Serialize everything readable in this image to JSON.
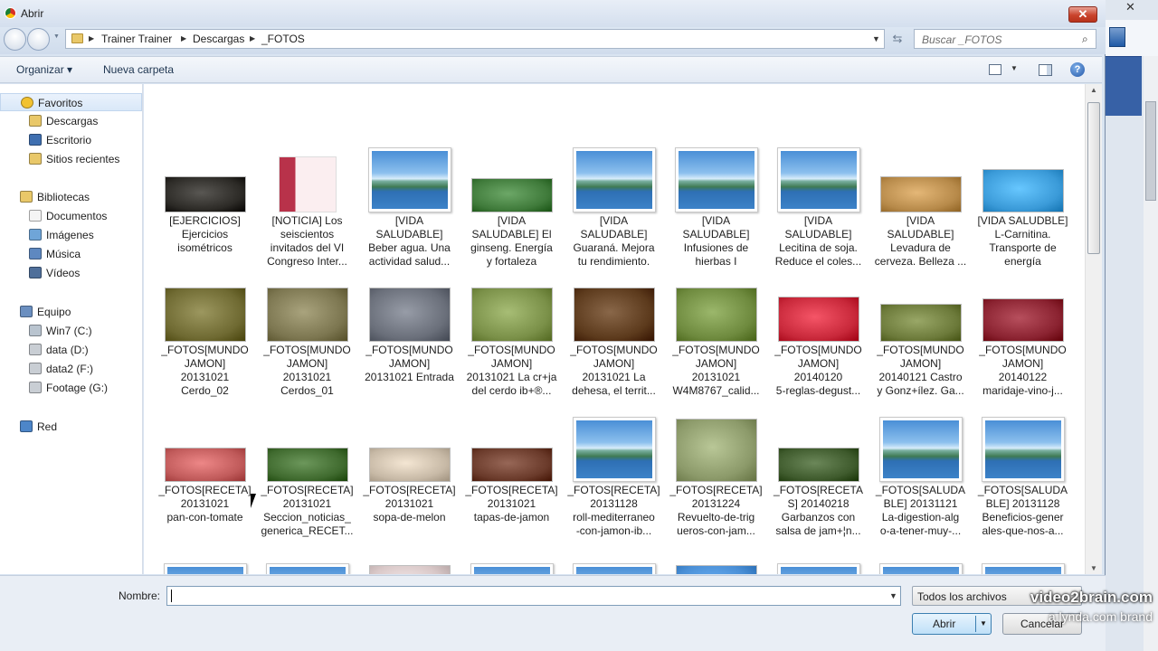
{
  "window": {
    "title": "Abrir",
    "close_glyph": "✕"
  },
  "address": {
    "crumbs": [
      "Trainer Trainer",
      "Descargas",
      "_FOTOS"
    ],
    "search_placeholder": "Buscar _FOTOS"
  },
  "toolbar": {
    "organize_label": "Organizar ▾",
    "new_folder_label": "Nueva carpeta",
    "help_glyph": "?"
  },
  "nav": {
    "items": [
      {
        "label": "Favoritos",
        "icon": "star-icon",
        "level": 0,
        "selected": true
      },
      {
        "label": "Descargas",
        "icon": "downloads-folder-icon",
        "level": 1
      },
      {
        "label": "Escritorio",
        "icon": "desktop-icon",
        "level": 1
      },
      {
        "label": "Sitios recientes",
        "icon": "recent-places-icon",
        "level": 1
      },
      {
        "label": "Bibliotecas",
        "icon": "libraries-icon",
        "level": 0
      },
      {
        "label": "Documentos",
        "icon": "documents-icon",
        "level": 1
      },
      {
        "label": "Imágenes",
        "icon": "pictures-icon",
        "level": 1
      },
      {
        "label": "Música",
        "icon": "music-icon",
        "level": 1
      },
      {
        "label": "Vídeos",
        "icon": "videos-icon",
        "level": 1
      },
      {
        "label": "Equipo",
        "icon": "computer-icon",
        "level": 0
      },
      {
        "label": "Win7 (C:)",
        "icon": "system-drive-icon",
        "level": 1
      },
      {
        "label": "data (D:)",
        "icon": "drive-icon",
        "level": 1
      },
      {
        "label": "data2 (F:)",
        "icon": "drive-icon",
        "level": 1
      },
      {
        "label": "Footage (G:)",
        "icon": "drive-icon",
        "level": 1
      },
      {
        "label": "Red",
        "icon": "network-icon",
        "level": 0
      }
    ]
  },
  "files": [
    {
      "caption": "[EJERCICIOS] Ejercicios isométricos",
      "lines": [
        "[EJERCICIOS]",
        "Ejercicios",
        "isométricos"
      ],
      "thumb": "photo-dark",
      "color": "#2c2a26"
    },
    {
      "caption": "[NOTICIA] Los seiscientos invitados del VI Congreso Inter...",
      "lines": [
        "[NOTICIA] Los",
        "seiscientos",
        "invitados del VI",
        "Congreso Inter..."
      ],
      "thumb": "document",
      "color": "#b8324a"
    },
    {
      "caption": "[VIDA SALUDABLE] Beber agua. Una actividad salud...",
      "lines": [
        "[VIDA",
        "SALUDABLE]",
        "Beber agua. Una",
        "actividad salud..."
      ],
      "thumb": "landscape"
    },
    {
      "caption": "[VIDA SALUDABLE] El ginseng. Energía y fortaleza",
      "lines": [
        "[VIDA",
        "SALUDABLE] El",
        "ginseng. Energía",
        "y fortaleza"
      ],
      "thumb": "photo",
      "color": "#3f7a3a"
    },
    {
      "caption": "[VIDA SALUDABLE] Guaraná. Mejora tu rendimiento.",
      "lines": [
        "[VIDA",
        "SALUDABLE]",
        "Guaraná. Mejora",
        "tu rendimiento."
      ],
      "thumb": "landscape"
    },
    {
      "caption": "[VIDA SALUDABLE] Infusiones de hierbas I",
      "lines": [
        "[VIDA",
        "SALUDABLE]",
        "Infusiones de",
        "hierbas I"
      ],
      "thumb": "landscape"
    },
    {
      "caption": "[VIDA SALUDABLE] Lecitina de soja. Reduce el coles...",
      "lines": [
        "[VIDA",
        "SALUDABLE]",
        "Lecitina de soja.",
        "Reduce el coles..."
      ],
      "thumb": "landscape"
    },
    {
      "caption": "[VIDA SALUDABLE] Levadura de cerveza. Belleza ...",
      "lines": [
        "[VIDA",
        "SALUDABLE]",
        "Levadura de",
        "cerveza. Belleza ..."
      ],
      "thumb": "photo",
      "color": "#b78a4a"
    },
    {
      "caption": "[VIDA SALUDBLE] L-Carnitina. Transporte de energía",
      "lines": [
        "[VIDA SALUDBLE]",
        "L-Carnitina.",
        "Transporte de",
        "energía"
      ],
      "thumb": "photo",
      "color": "#3a9ad8"
    },
    {
      "caption": "_FOTOS[MUNDO JAMON] 20131021 Cerdo_02",
      "lines": [
        "_FOTOS[MUNDO",
        "JAMON]",
        "20131021",
        "Cerdo_02"
      ],
      "thumb": "photo",
      "color": "#6f6a32"
    },
    {
      "caption": "_FOTOS[MUNDO JAMON] 20131021 Cerdos_01",
      "lines": [
        "_FOTOS[MUNDO",
        "JAMON]",
        "20131021",
        "Cerdos_01"
      ],
      "thumb": "photo",
      "color": "#7c7650"
    },
    {
      "caption": "_FOTOS[MUNDO JAMON] 20131021 Entrada",
      "lines": [
        "_FOTOS[MUNDO",
        "JAMON]",
        "20131021 Entrada"
      ],
      "thumb": "photo",
      "color": "#6a6f7a"
    },
    {
      "caption": "_FOTOS[MUNDO JAMON] 20131021 La cr+ja del cerdo ib+®...",
      "lines": [
        "_FOTOS[MUNDO",
        "JAMON]",
        "20131021 La cr+ja",
        "del cerdo ib+®..."
      ],
      "thumb": "photo",
      "color": "#7a9048"
    },
    {
      "caption": "_FOTOS[MUNDO JAMON] 20131021 La dehesa, el territ...",
      "lines": [
        "_FOTOS[MUNDO",
        "JAMON]",
        "20131021 La",
        "dehesa, el territ..."
      ],
      "thumb": "photo",
      "color": "#5c3a1c"
    },
    {
      "caption": "_FOTOS[MUNDO JAMON] 20131021 W4M8767_calid...",
      "lines": [
        "_FOTOS[MUNDO",
        "JAMON]",
        "20131021",
        "W4M8767_calid..."
      ],
      "thumb": "photo",
      "color": "#6e8a3e"
    },
    {
      "caption": "_FOTOS[MUNDO JAMON] 20140120 5-reglas-degust...",
      "lines": [
        "_FOTOS[MUNDO",
        "JAMON]",
        "20140120",
        "5-reglas-degust..."
      ],
      "thumb": "photo",
      "color": "#c8283a"
    },
    {
      "caption": "_FOTOS[MUNDO JAMON] 20140121 Castro y Gonz+ílez. Ga...",
      "lines": [
        "_FOTOS[MUNDO",
        "JAMON]",
        "20140121 Castro",
        "y Gonz+ílez. Ga..."
      ],
      "thumb": "photo",
      "color": "#6c7a3a"
    },
    {
      "caption": "_FOTOS[MUNDO JAMON] 20140122 maridaje-vino-j...",
      "lines": [
        "_FOTOS[MUNDO",
        "JAMON]",
        "20140122",
        "maridaje-vino-j..."
      ],
      "thumb": "photo",
      "color": "#8a2230"
    },
    {
      "caption": "_FOTOS[RECETA] 20131021 pan-con-tomate",
      "lines": [
        "_FOTOS[RECETA]",
        "20131021",
        "pan-con-tomate"
      ],
      "thumb": "photo",
      "color": "#c05a5a"
    },
    {
      "caption": "_FOTOS[RECETA] 20131021 Seccion_noticias_generica_RECET...",
      "lines": [
        "_FOTOS[RECETA]",
        "20131021",
        "Seccion_noticias_",
        "generica_RECET..."
      ],
      "thumb": "photo",
      "color": "#3f6a2e"
    },
    {
      "caption": "_FOTOS[RECETA] 20131021 sopa-de-melon",
      "lines": [
        "_FOTOS[RECETA]",
        "20131021",
        "sopa-de-melon"
      ],
      "thumb": "photo",
      "color": "#c7b9a6"
    },
    {
      "caption": "_FOTOS[RECETA] 20131021 tapas-de-jamon",
      "lines": [
        "_FOTOS[RECETA]",
        "20131021",
        "tapas-de-jamon"
      ],
      "thumb": "photo",
      "color": "#6a3a2a"
    },
    {
      "caption": "_FOTOS[RECETA] 20131128 roll-mediterraneo-con-jamon-ib...",
      "lines": [
        "_FOTOS[RECETA]",
        "20131128",
        "roll-mediterraneo",
        "-con-jamon-ib..."
      ],
      "thumb": "landscape"
    },
    {
      "caption": "_FOTOS[RECETA] 20131224 Revuelto-de-trigueros-con-jam...",
      "lines": [
        "_FOTOS[RECETA]",
        "20131224",
        "Revuelto-de-trig",
        "ueros-con-jam..."
      ],
      "thumb": "photo",
      "color": "#8c9a6a"
    },
    {
      "caption": "_FOTOS[RECETAS] 20140218 Garbanzos con salsa de jam+¦n...",
      "lines": [
        "_FOTOS[RECETA",
        "S] 20140218",
        "Garbanzos con",
        "salsa de jam+¦n..."
      ],
      "thumb": "photo",
      "color": "#3e5a2c"
    },
    {
      "caption": "_FOTOS[SALUDABLE] 20131121 La-digestion-algo-a-tener-muy-...",
      "lines": [
        "_FOTOS[SALUDA",
        "BLE] 20131121",
        "La-digestion-alg",
        "o-a-tener-muy-..."
      ],
      "thumb": "landscape"
    },
    {
      "caption": "_FOTOS[SALUDABLE] 20131128 Beneficios-generales-que-nos-a...",
      "lines": [
        "_FOTOS[SALUDA",
        "BLE] 20131128",
        "Beneficios-gener",
        "ales-que-nos-a..."
      ],
      "thumb": "landscape"
    },
    {
      "caption": "",
      "lines": [],
      "thumb": "landscape"
    },
    {
      "caption": "",
      "lines": [],
      "thumb": "landscape"
    },
    {
      "caption": "",
      "lines": [],
      "thumb": "photo",
      "color": "#d9c8c8"
    },
    {
      "caption": "",
      "lines": [],
      "thumb": "landscape"
    },
    {
      "caption": "",
      "lines": [],
      "thumb": "landscape"
    },
    {
      "caption": "",
      "lines": [],
      "thumb": "photo",
      "color": "#4a8fd6"
    },
    {
      "caption": "",
      "lines": [],
      "thumb": "landscape"
    },
    {
      "caption": "",
      "lines": [],
      "thumb": "landscape"
    },
    {
      "caption": "",
      "lines": [],
      "thumb": "landscape"
    }
  ],
  "bottom": {
    "filename_label": "Nombre:",
    "filename_value": "",
    "filetype_label": "Todos los archivos",
    "open_label": "Abrir",
    "cancel_label": "Cancelar"
  },
  "watermark": {
    "line1": "video2brain.com",
    "line2": "a lynda.com brand"
  },
  "colors": {
    "accent": "#3c7fb1",
    "selection": "#d9e8f8",
    "close": "#c9432c"
  }
}
